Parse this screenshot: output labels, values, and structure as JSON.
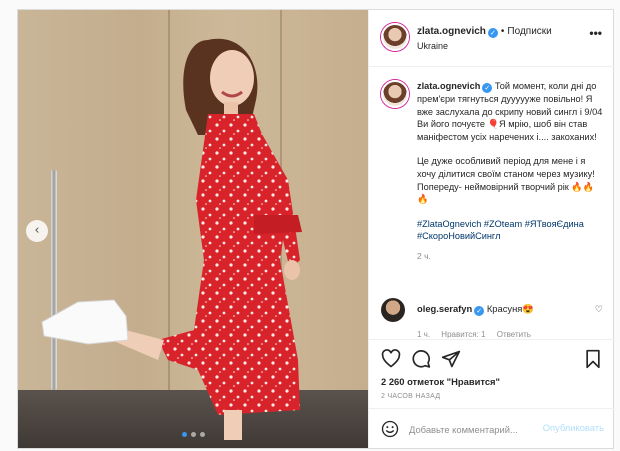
{
  "header": {
    "username": "zlata.ognevich",
    "separator": "•",
    "follow_label": "Подписки",
    "location": "Ukraine",
    "more_glyph": "•••"
  },
  "caption": {
    "username": "zlata.ognevich",
    "paragraph1": "Той момент, коли дні до прем'єри тягнуться дуууууже повільно! Я вже заслухала до скрипу новий сингл і 9/04 Ви його почуєте 🎈Я мрію, шоб він став маніфестом усіх наречених і.... закоханих!",
    "paragraph2": "Це дуже особливий період для мене і я хочу ділитися своїм станом через музику! Попереду- неймовірний творчий рік 🔥🔥🔥",
    "hashtags": "#ZlataOgnevich #ZOteam #ЯТвояЄдина #СкороНовийСингл",
    "time": "2 ч."
  },
  "reply": {
    "username": "oleg.serafyn",
    "text": "Красуня😍",
    "time": "1 ч.",
    "likes": "Нравится: 1",
    "reply_label": "Ответить"
  },
  "stats": {
    "likes": "2 260 отметок \"Нравится\"",
    "ago": "2 ЧАСОВ НАЗАД"
  },
  "comment_box": {
    "placeholder": "Добавьте комментарий...",
    "publish_label": "Опубликовать"
  },
  "carousel": {
    "prev_glyph": "‹",
    "slides": 3,
    "active_slide": 1
  },
  "colors": {
    "accent": "#3897f0",
    "publish_disabled": "#b2dffc",
    "dress": "#d8232a"
  }
}
